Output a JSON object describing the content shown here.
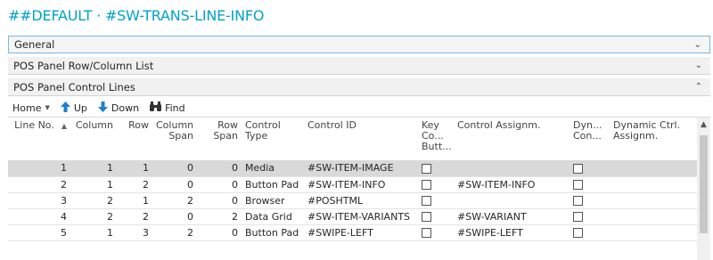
{
  "page": {
    "title": "##DEFAULT · #SW-TRANS-LINE-INFO"
  },
  "fasttabs": [
    {
      "label": "General",
      "state": "collapsed"
    },
    {
      "label": "POS Panel Row/Column List",
      "state": "collapsed"
    },
    {
      "label": "POS Panel Control Lines",
      "state": "expanded"
    }
  ],
  "toolbar": {
    "home_label": "Home",
    "up_label": "Up",
    "down_label": "Down",
    "find_label": "Find"
  },
  "grid": {
    "headers": {
      "line_no": "Line No.",
      "column": "Column",
      "row": "Row",
      "column_span": "Column Span",
      "row_span": "Row Span",
      "control_type": "Control Type",
      "control_id": "Control ID",
      "key_co_butt": "Key Co... Butt...",
      "control_assignm": "Control Assignm.",
      "dyn_con": "Dyn... Con...",
      "dynamic_ctrl_assignm": "Dynamic Ctrl. Assignm."
    },
    "rows": [
      {
        "line_no": "1",
        "column": "1",
        "row": "1",
        "column_span": "0",
        "row_span": "0",
        "control_type": "Media",
        "control_id": "#SW-ITEM-IMAGE",
        "key_checked": false,
        "control_assignm": "",
        "dyn_checked": false,
        "dynamic_ctrl_assignm": ""
      },
      {
        "line_no": "2",
        "column": "1",
        "row": "2",
        "column_span": "0",
        "row_span": "0",
        "control_type": "Button Pad",
        "control_id": "#SW-ITEM-INFO",
        "key_checked": false,
        "control_assignm": "#SW-ITEM-INFO",
        "dyn_checked": false,
        "dynamic_ctrl_assignm": ""
      },
      {
        "line_no": "3",
        "column": "2",
        "row": "1",
        "column_span": "2",
        "row_span": "0",
        "control_type": "Browser",
        "control_id": "#POSHTML",
        "key_checked": false,
        "control_assignm": "",
        "dyn_checked": false,
        "dynamic_ctrl_assignm": ""
      },
      {
        "line_no": "4",
        "column": "2",
        "row": "2",
        "column_span": "0",
        "row_span": "2",
        "control_type": "Data Grid",
        "control_id": "#SW-ITEM-VARIANTS",
        "key_checked": false,
        "control_assignm": "#SW-VARIANT",
        "dyn_checked": false,
        "dynamic_ctrl_assignm": ""
      },
      {
        "line_no": "5",
        "column": "1",
        "row": "3",
        "column_span": "2",
        "row_span": "0",
        "control_type": "Button Pad",
        "control_id": "#SWIPE-LEFT",
        "key_checked": false,
        "control_assignm": "#SWIPE-LEFT",
        "dyn_checked": false,
        "dynamic_ctrl_assignm": ""
      }
    ]
  }
}
